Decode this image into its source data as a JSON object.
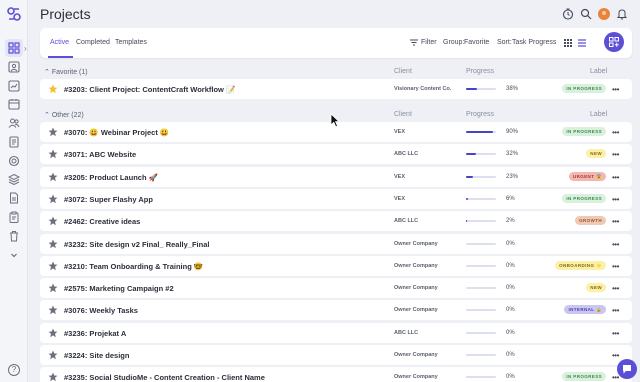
{
  "page": {
    "title": "Projects"
  },
  "tabs": [
    {
      "label": "Active",
      "active": true
    },
    {
      "label": "Completed",
      "active": false
    },
    {
      "label": "Templates",
      "active": false
    }
  ],
  "toolbar": {
    "filter": "Filter",
    "group_label": "Group:",
    "group_value": "Favorite",
    "sort_label": "Sort:",
    "sort_value": "Task Progress"
  },
  "columns": {
    "client": "Client",
    "progress": "Progress",
    "label": "Label"
  },
  "groups": [
    {
      "title": "Favorite (1)"
    },
    {
      "title": "Other (22)"
    }
  ],
  "favorite_rows": [
    {
      "title": "#3203: Client Project: ContentCraft Workflow 📝",
      "client": "Visionary Content Co.",
      "progress": 38,
      "progress_text": "38%",
      "label": "IN PROGRESS",
      "label_color": "#d8f0dc",
      "label_text_color": "#3f8a50",
      "starred": true
    }
  ],
  "other_rows": [
    {
      "title": "#3070: 😃 Webinar Project 😃",
      "client": "VEX",
      "progress": 90,
      "progress_text": "90%",
      "label": "IN PROGRESS",
      "label_color": "#d8f0dc",
      "label_text_color": "#3f8a50"
    },
    {
      "title": "#3071: ABC Website",
      "client": "ABC LLC",
      "progress": 32,
      "progress_text": "32%",
      "label": "NEW",
      "label_color": "#fbf0a6",
      "label_text_color": "#7d6a12"
    },
    {
      "title": "#3205: Product Launch 🚀",
      "client": "VEX",
      "progress": 23,
      "progress_text": "23%",
      "label": "URGENT 😨",
      "label_color": "#f4b6b0",
      "label_text_color": "#a33a32"
    },
    {
      "title": "#3072: Super Flashy App",
      "client": "VEX",
      "progress": 6,
      "progress_text": "6%",
      "label": "IN PROGRESS",
      "label_color": "#d8f0dc",
      "label_text_color": "#3f8a50"
    },
    {
      "title": "#2462: Creative ideas",
      "client": "ABC LLC",
      "progress": 2,
      "progress_text": "2%",
      "label": "GROWTH",
      "label_color": "#f1c9b3",
      "label_text_color": "#94533a"
    },
    {
      "title": "#3232: Site design v2 Final_ Really_Final",
      "client": "Owner Company",
      "progress": 0,
      "progress_text": "0%",
      "label": "",
      "label_color": "",
      "label_text_color": ""
    },
    {
      "title": "#3210: Team Onboarding & Training 🤓",
      "client": "Owner Company",
      "progress": 0,
      "progress_text": "0%",
      "label": "ONBOARDING ⭐",
      "label_color": "#fbf0a6",
      "label_text_color": "#7d6a12"
    },
    {
      "title": "#2575: Marketing Campaign #2",
      "client": "Owner Company",
      "progress": 0,
      "progress_text": "0%",
      "label": "NEW",
      "label_color": "#fbf0a6",
      "label_text_color": "#7d6a12"
    },
    {
      "title": "#3076: Weekly Tasks",
      "client": "Owner Company",
      "progress": 0,
      "progress_text": "0%",
      "label": "INTERNAL 🔒",
      "label_color": "#c9c6f2",
      "label_text_color": "#4a43a8"
    },
    {
      "title": "#3236: Projekat A",
      "client": "ABC LLC",
      "progress": 0,
      "progress_text": "0%",
      "label": "",
      "label_color": "",
      "label_text_color": ""
    },
    {
      "title": "#3224: Site design",
      "client": "Owner Company",
      "progress": 0,
      "progress_text": "0%",
      "label": "",
      "label_color": "",
      "label_text_color": ""
    },
    {
      "title": "#3235: Social StudioMe - Content Creation - Client Name",
      "client": "Owner Company",
      "progress": 0,
      "progress_text": "0%",
      "label": "IN PROGRESS",
      "label_color": "#d8f0dc",
      "label_text_color": "#3f8a50"
    }
  ],
  "colors": {
    "accent": "#5b4fd6",
    "star_favorite": "#f2c033",
    "star_default": "#6b6f7e"
  }
}
